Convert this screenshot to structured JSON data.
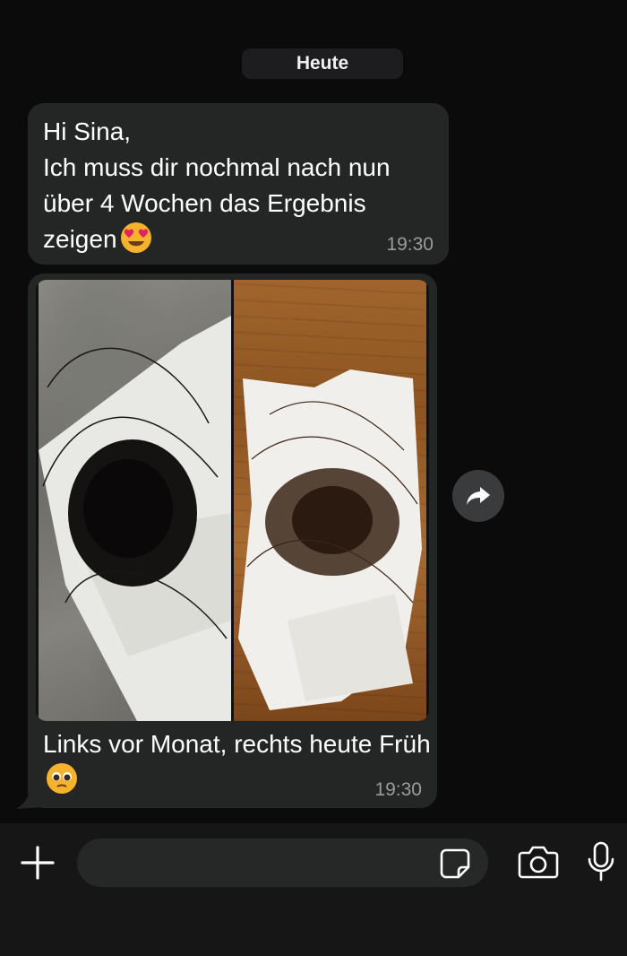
{
  "date_separator": "Heute",
  "messages": [
    {
      "text": "Hi Sina,\nIch muss dir nochmal nach nun über 4 Wochen das Ergebnis zeigen",
      "emoji": "smiling-face-with-heart-eyes",
      "time": "19:30"
    },
    {
      "has_photo": true,
      "text": "Links vor Monat, rechts heute Früh",
      "emoji": "pleading-face",
      "time": "19:30"
    }
  ],
  "input": {
    "value": "",
    "placeholder": ""
  },
  "icons": {
    "forward": "forward-icon",
    "plus": "plus-icon",
    "sticker": "sticker-icon",
    "camera": "camera-icon",
    "mic": "microphone-icon"
  },
  "colors": {
    "background": "#0b0b0b",
    "bubble": "#242626",
    "timestamp": "#9a9c9c",
    "input_bar": "#161616"
  }
}
